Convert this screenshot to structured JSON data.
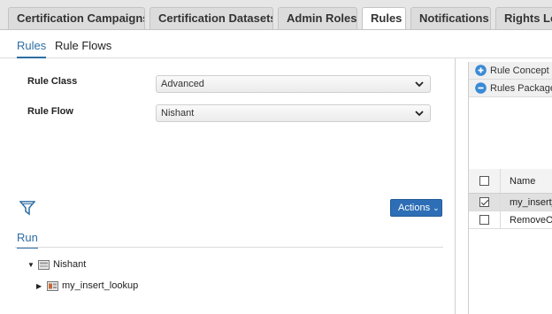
{
  "top_tabs": [
    {
      "label": "Certification Campaigns",
      "active": false
    },
    {
      "label": "Certification Datasets",
      "active": false
    },
    {
      "label": "Admin Roles",
      "active": false
    },
    {
      "label": "Rules",
      "active": true
    },
    {
      "label": "Notifications",
      "active": false
    },
    {
      "label": "Rights Lo",
      "active": false
    }
  ],
  "sub_tabs": [
    {
      "label": "Rules",
      "active": true
    },
    {
      "label": "Rule Flows",
      "active": false
    }
  ],
  "form": {
    "rule_class": {
      "label": "Rule Class",
      "value": "Advanced"
    },
    "rule_flow": {
      "label": "Rule Flow",
      "value": "Nishant"
    }
  },
  "toolbar": {
    "actions_label": "Actions"
  },
  "run_tab": {
    "label": "Run"
  },
  "tree": {
    "root": {
      "label": "Nishant",
      "expanded": true
    },
    "child": {
      "label": "my_insert_lookup",
      "expanded": false
    }
  },
  "right_panel": {
    "rule_concept": {
      "label": "Rule Concept",
      "icon": "plus-circle-icon"
    },
    "rules_package": {
      "label": "Rules Package",
      "icon": "minus-circle-icon"
    },
    "grid": {
      "header": "Name",
      "rows": [
        {
          "name": "my_insert_",
          "checked": true
        },
        {
          "name": "RemoveOv",
          "checked": false
        }
      ]
    }
  },
  "colors": {
    "accent": "#2e6da4",
    "button": "#2d6eb6",
    "background": "#e6e6e6"
  }
}
